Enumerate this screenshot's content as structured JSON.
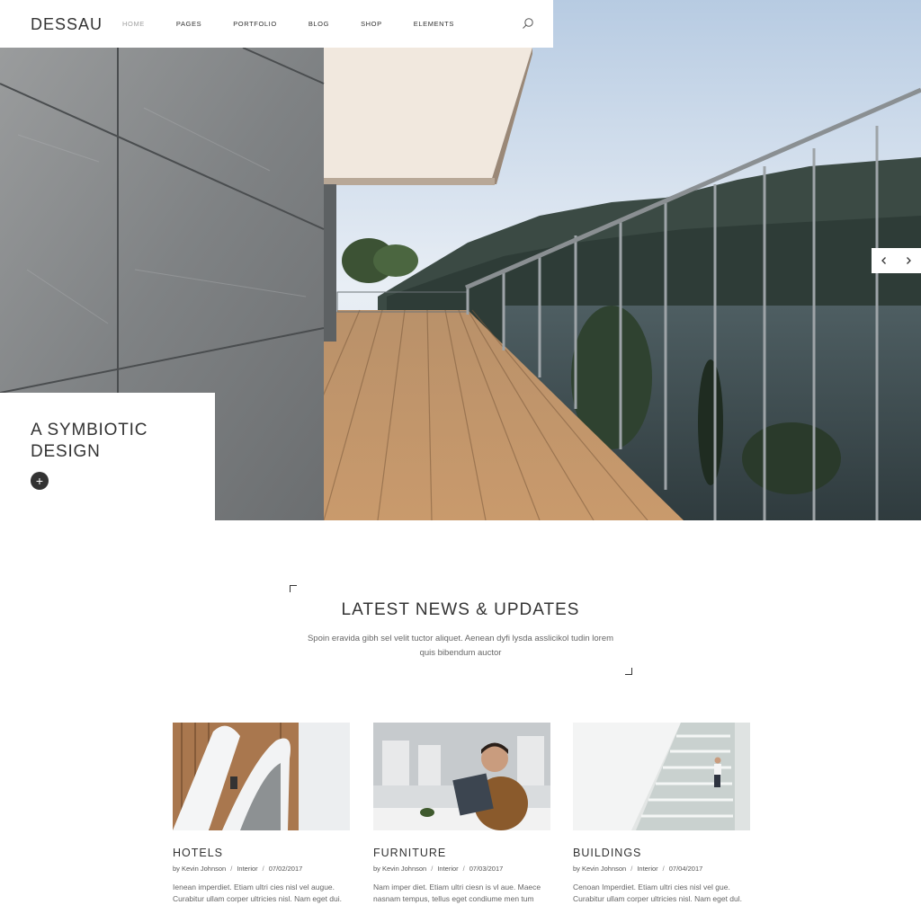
{
  "brand": {
    "logo": "DESSAU"
  },
  "nav": {
    "items": [
      {
        "label": "HOME",
        "active": true
      },
      {
        "label": "PAGES",
        "active": false
      },
      {
        "label": "PORTFOLIO",
        "active": false
      },
      {
        "label": "BLOG",
        "active": false
      },
      {
        "label": "SHOP",
        "active": false
      },
      {
        "label": "ELEMENTS",
        "active": false
      }
    ],
    "search_icon": "search-icon"
  },
  "hero": {
    "caption": "A SYMBIOTIC\nDESIGN",
    "plus_label": "+",
    "prev_icon": "chevron-left-icon",
    "next_icon": "chevron-right-icon"
  },
  "news": {
    "heading": "LATEST NEWS & UPDATES",
    "subheading": "Spoin eravida gibh sel velit tuctor aliquet. Aenean dyfi lysda asslicikol tudin lorem quis bibendum auctor",
    "cards": [
      {
        "title": "HOTELS",
        "author": "by Kevin Johnson",
        "category": "Interior",
        "date": "07/02/2017",
        "excerpt": "Ienean imperdiet. Etiam ultri cies nisl vel augue. Curabitur ullam corper ultricies nisl. Nam eget dui."
      },
      {
        "title": "FURNITURE",
        "author": "by Kevin Johnson",
        "category": "Interior",
        "date": "07/03/2017",
        "excerpt": "Nam imper diet. Etiam ultri ciesn is vl aue. Maece nasnam tempus, tellus eget condiume men tum"
      },
      {
        "title": "BUILDINGS",
        "author": "by Kevin Johnson",
        "category": "Interior",
        "date": "07/04/2017",
        "excerpt": "Cenoan Imperdiet. Etiam ultri cies nisl vel gue. Curabitur ullam corper ultricies nisl. Nam eget dul."
      }
    ]
  },
  "colors": {
    "text": "#333333",
    "muted": "#a0a0a0",
    "accent_dark": "#333333"
  }
}
